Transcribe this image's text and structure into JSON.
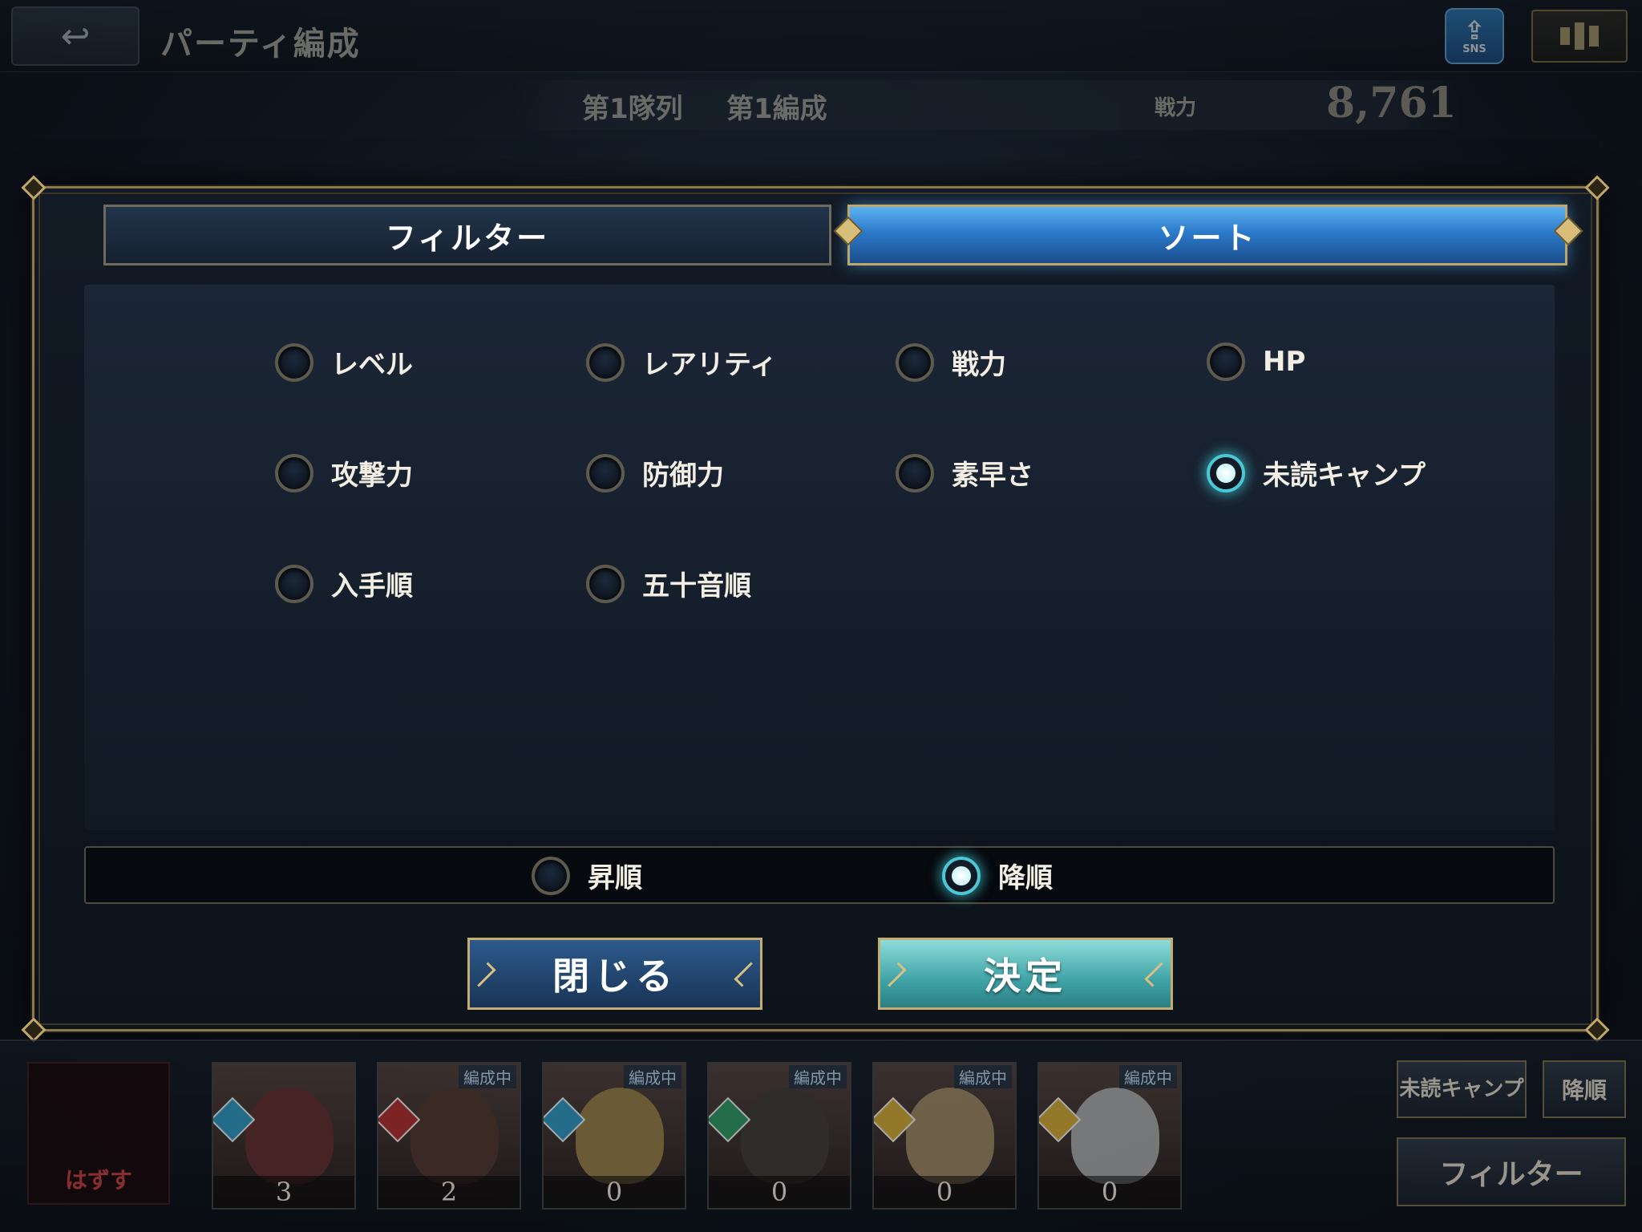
{
  "header": {
    "back_icon": "back-arrow-icon",
    "title": "パーティ編成",
    "sns_label": "SNS",
    "ranking_icon": "ranking-icon"
  },
  "team": {
    "queue": "第1隊列",
    "formation": "第1編成",
    "power_label": "戦力",
    "power_value": "8,761"
  },
  "modal": {
    "tabs": [
      {
        "label": "フィルター",
        "active": false
      },
      {
        "label": "ソート",
        "active": true
      }
    ],
    "sort_options": [
      {
        "label": "レベル",
        "selected": false
      },
      {
        "label": "レアリティ",
        "selected": false
      },
      {
        "label": "戦力",
        "selected": false
      },
      {
        "label": "HP",
        "selected": false
      },
      {
        "label": "攻撃力",
        "selected": false
      },
      {
        "label": "防御力",
        "selected": false
      },
      {
        "label": "素早さ",
        "selected": false
      },
      {
        "label": "未読キャンプ",
        "selected": true
      },
      {
        "label": "入手順",
        "selected": false
      },
      {
        "label": "五十音順",
        "selected": false
      }
    ],
    "order": {
      "ascending": {
        "label": "昇順",
        "selected": false
      },
      "descending": {
        "label": "降順",
        "selected": true
      }
    },
    "close_label": "閉じる",
    "confirm_label": "決定"
  },
  "bottom": {
    "remove_label": "はずす",
    "characters": [
      {
        "count": "3",
        "tag": "",
        "color": "#5a2a2a"
      },
      {
        "count": "2",
        "tag": "編成中",
        "color": "#4a3228"
      },
      {
        "count": "0",
        "tag": "編成中",
        "color": "#8a7440"
      },
      {
        "count": "0",
        "tag": "編成中",
        "color": "#3a3632"
      },
      {
        "count": "0",
        "tag": "編成中",
        "color": "#8f7a58"
      },
      {
        "count": "0",
        "tag": "編成中",
        "color": "#9a9a9a"
      }
    ],
    "sort_label": "未読キャンプ",
    "order_label": "降順",
    "filter_label": "フィルター"
  },
  "colors": {
    "accent_gold": "#bfa66a",
    "active_tab_blue": "#2b7acb",
    "confirm_teal": "#3fa3a6",
    "selected_glow": "#4ac8d6"
  }
}
